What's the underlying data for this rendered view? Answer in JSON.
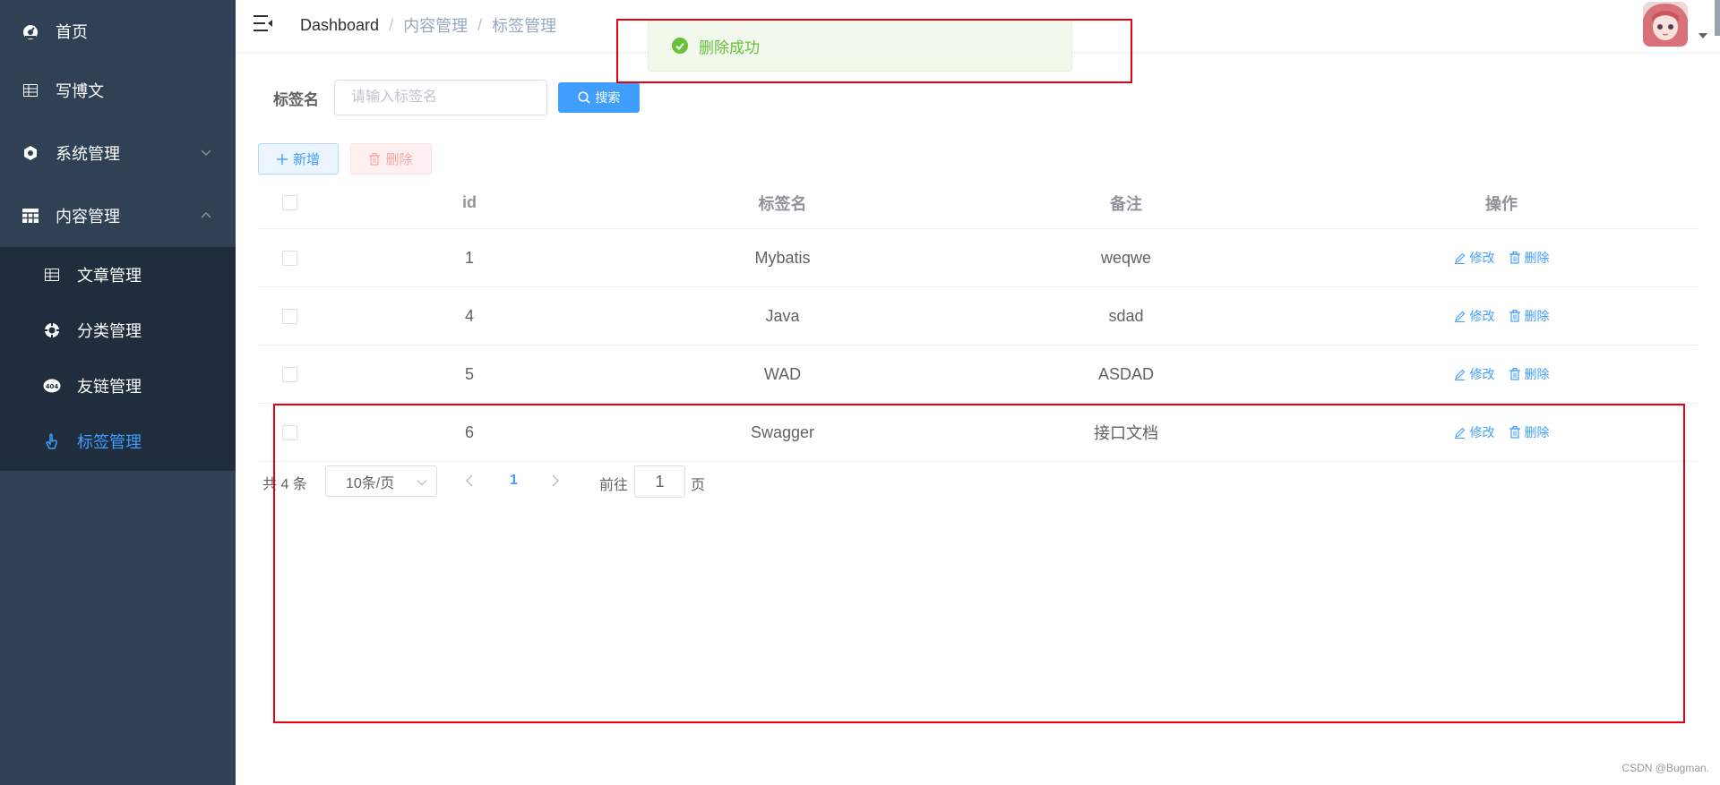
{
  "sidebar": {
    "items": [
      {
        "label": "首页",
        "icon": "dashboard-icon"
      },
      {
        "label": "写博文",
        "icon": "table-icon"
      },
      {
        "label": "系统管理",
        "icon": "gear-icon",
        "expanded": false
      },
      {
        "label": "内容管理",
        "icon": "grid-icon",
        "expanded": true
      }
    ],
    "subitems": [
      {
        "label": "文章管理",
        "icon": "table-icon"
      },
      {
        "label": "分类管理",
        "icon": "lifebuoy-icon"
      },
      {
        "label": "友链管理",
        "icon": "404-icon"
      },
      {
        "label": "标签管理",
        "icon": "tag-hand-icon",
        "active": true
      }
    ]
  },
  "header": {
    "breadcrumb": [
      "Dashboard",
      "内容管理",
      "标签管理"
    ]
  },
  "toast": {
    "message": "删除成功"
  },
  "search": {
    "label": "标签名",
    "placeholder": "请输入标签名",
    "button": "搜索"
  },
  "toolbar": {
    "add_label": "新增",
    "delete_label": "删除"
  },
  "table": {
    "columns": [
      "id",
      "标签名",
      "备注",
      "操作"
    ],
    "rows": [
      {
        "id": "1",
        "name": "Mybatis",
        "remark": "weqwe"
      },
      {
        "id": "4",
        "name": "Java",
        "remark": "sdad"
      },
      {
        "id": "5",
        "name": "WAD",
        "remark": "ASDAD"
      },
      {
        "id": "6",
        "name": "Swagger",
        "remark": "接口文档"
      }
    ],
    "edit_label": "修改",
    "delete_label": "删除"
  },
  "pagination": {
    "total_text": "共 4 条",
    "page_size": "10条/页",
    "current_page": "1",
    "jump_prefix": "前往",
    "jump_value": "1",
    "jump_suffix": "页"
  },
  "watermark": "CSDN @Bugman.",
  "colors": {
    "sidebar_bg": "#304156",
    "submenu_bg": "#1f2d3d",
    "primary": "#409eff",
    "success": "#67c23a",
    "danger": "#f56c6c",
    "annotation": "#e60012"
  }
}
